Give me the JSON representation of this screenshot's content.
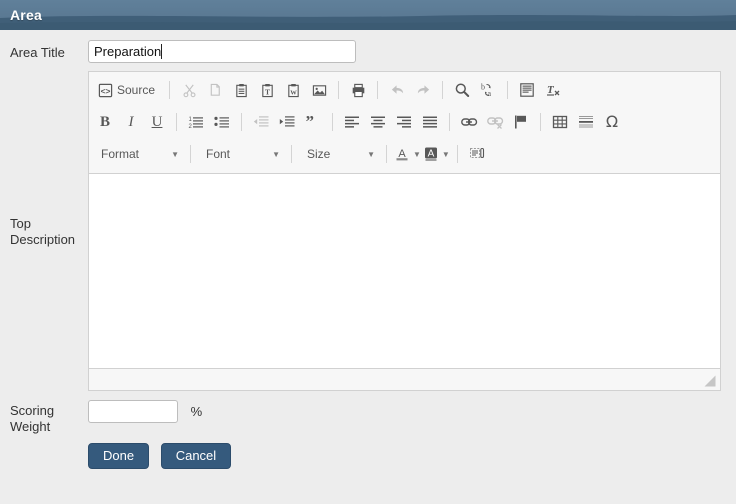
{
  "window": {
    "title": "Area",
    "header_color": "#4a6880"
  },
  "form": {
    "area_title": {
      "label": "Area Title",
      "value": "Preparation",
      "placeholder": ""
    },
    "top_description": {
      "label": "Top Description",
      "label_line1": "Top",
      "label_line2": "Description",
      "content": ""
    },
    "scoring_weight": {
      "label": "Scoring Weight",
      "label_line1": "Scoring",
      "label_line2": "Weight",
      "value": "",
      "placeholder": "",
      "unit": "%"
    }
  },
  "buttons": {
    "done": "Done",
    "cancel": "Cancel",
    "accent_color": "#355a7d"
  },
  "editor": {
    "toolbar": {
      "row1": [
        {
          "name": "source-button",
          "label": "Source",
          "icon": "source-icon",
          "disabled": false
        },
        {
          "name": "separator",
          "label": "",
          "icon": "separator",
          "disabled": false
        },
        {
          "name": "cut-button",
          "label": "Cut",
          "icon": "scissors-icon",
          "disabled": true
        },
        {
          "name": "copy-button",
          "label": "Copy",
          "icon": "copy-icon",
          "disabled": true
        },
        {
          "name": "paste-button",
          "label": "Paste",
          "icon": "paste-icon",
          "disabled": false
        },
        {
          "name": "paste-text-button",
          "label": "Paste as plain text",
          "icon": "paste-text-icon",
          "disabled": false
        },
        {
          "name": "paste-word-button",
          "label": "Paste from Word",
          "icon": "paste-word-icon",
          "disabled": false
        },
        {
          "name": "image-button",
          "label": "Image",
          "icon": "image-icon",
          "disabled": false
        },
        {
          "name": "separator",
          "label": "",
          "icon": "separator",
          "disabled": false
        },
        {
          "name": "print-button",
          "label": "Print",
          "icon": "printer-icon",
          "disabled": false
        },
        {
          "name": "separator",
          "label": "",
          "icon": "separator",
          "disabled": false
        },
        {
          "name": "undo-button",
          "label": "Undo",
          "icon": "undo-arrow-icon",
          "disabled": true
        },
        {
          "name": "redo-button",
          "label": "Redo",
          "icon": "redo-arrow-icon",
          "disabled": true
        },
        {
          "name": "separator",
          "label": "",
          "icon": "separator",
          "disabled": false
        },
        {
          "name": "find-button",
          "label": "Find",
          "icon": "magnifier-icon",
          "disabled": false
        },
        {
          "name": "replace-button",
          "label": "Replace",
          "icon": "replace-icon",
          "disabled": false
        },
        {
          "name": "separator",
          "label": "",
          "icon": "separator",
          "disabled": false
        },
        {
          "name": "select-all-button",
          "label": "Select All",
          "icon": "select-all-icon",
          "disabled": false
        },
        {
          "name": "remove-format-button",
          "label": "Remove Format",
          "icon": "remove-format-icon",
          "disabled": false
        }
      ],
      "row2": [
        {
          "name": "bold-button",
          "label": "Bold",
          "icon": "bold-icon",
          "disabled": false
        },
        {
          "name": "italic-button",
          "label": "Italic",
          "icon": "italic-icon",
          "disabled": false
        },
        {
          "name": "underline-button",
          "label": "Underline",
          "icon": "underline-icon",
          "disabled": false
        },
        {
          "name": "separator",
          "label": "",
          "icon": "separator",
          "disabled": false
        },
        {
          "name": "numbered-list-button",
          "label": "Insert/Remove Numbered List",
          "icon": "numbered-list-icon",
          "disabled": false
        },
        {
          "name": "bulleted-list-button",
          "label": "Insert/Remove Bulleted List",
          "icon": "bulleted-list-icon",
          "disabled": false
        },
        {
          "name": "separator",
          "label": "",
          "icon": "separator",
          "disabled": false
        },
        {
          "name": "outdent-button",
          "label": "Decrease Indent",
          "icon": "outdent-icon",
          "disabled": true
        },
        {
          "name": "indent-button",
          "label": "Increase Indent",
          "icon": "indent-icon",
          "disabled": false
        },
        {
          "name": "blockquote-button",
          "label": "Block Quote",
          "icon": "quote-icon",
          "disabled": false
        },
        {
          "name": "separator",
          "label": "",
          "icon": "separator",
          "disabled": false
        },
        {
          "name": "align-left-button",
          "label": "Align Left",
          "icon": "align-left-icon",
          "disabled": false
        },
        {
          "name": "align-center-button",
          "label": "Center",
          "icon": "align-center-icon",
          "disabled": false
        },
        {
          "name": "align-right-button",
          "label": "Align Right",
          "icon": "align-right-icon",
          "disabled": false
        },
        {
          "name": "justify-button",
          "label": "Justify",
          "icon": "justify-icon",
          "disabled": false
        },
        {
          "name": "separator",
          "label": "",
          "icon": "separator",
          "disabled": false
        },
        {
          "name": "link-button",
          "label": "Link",
          "icon": "link-icon",
          "disabled": false
        },
        {
          "name": "unlink-button",
          "label": "Unlink",
          "icon": "unlink-icon",
          "disabled": true
        },
        {
          "name": "anchor-button",
          "label": "Anchor",
          "icon": "flag-icon",
          "disabled": false
        },
        {
          "name": "separator",
          "label": "",
          "icon": "separator",
          "disabled": false
        },
        {
          "name": "table-button",
          "label": "Table",
          "icon": "table-icon",
          "disabled": false
        },
        {
          "name": "horizontal-rule-button",
          "label": "Horizontal Line",
          "icon": "horizontal-rule-icon",
          "disabled": false
        },
        {
          "name": "special-char-button",
          "label": "Insert Special Character",
          "icon": "omega-icon",
          "disabled": false
        }
      ],
      "row3": {
        "format": {
          "label": "Format",
          "name": "format-dropdown"
        },
        "font": {
          "label": "Font",
          "name": "font-dropdown"
        },
        "size": {
          "label": "Size",
          "name": "size-dropdown"
        },
        "text_color": {
          "label": "A",
          "name": "text-color-button"
        },
        "bg_color": {
          "label": "A",
          "name": "background-color-button"
        },
        "show_blocks": {
          "label": "Show Blocks",
          "name": "show-blocks-button"
        }
      }
    }
  }
}
